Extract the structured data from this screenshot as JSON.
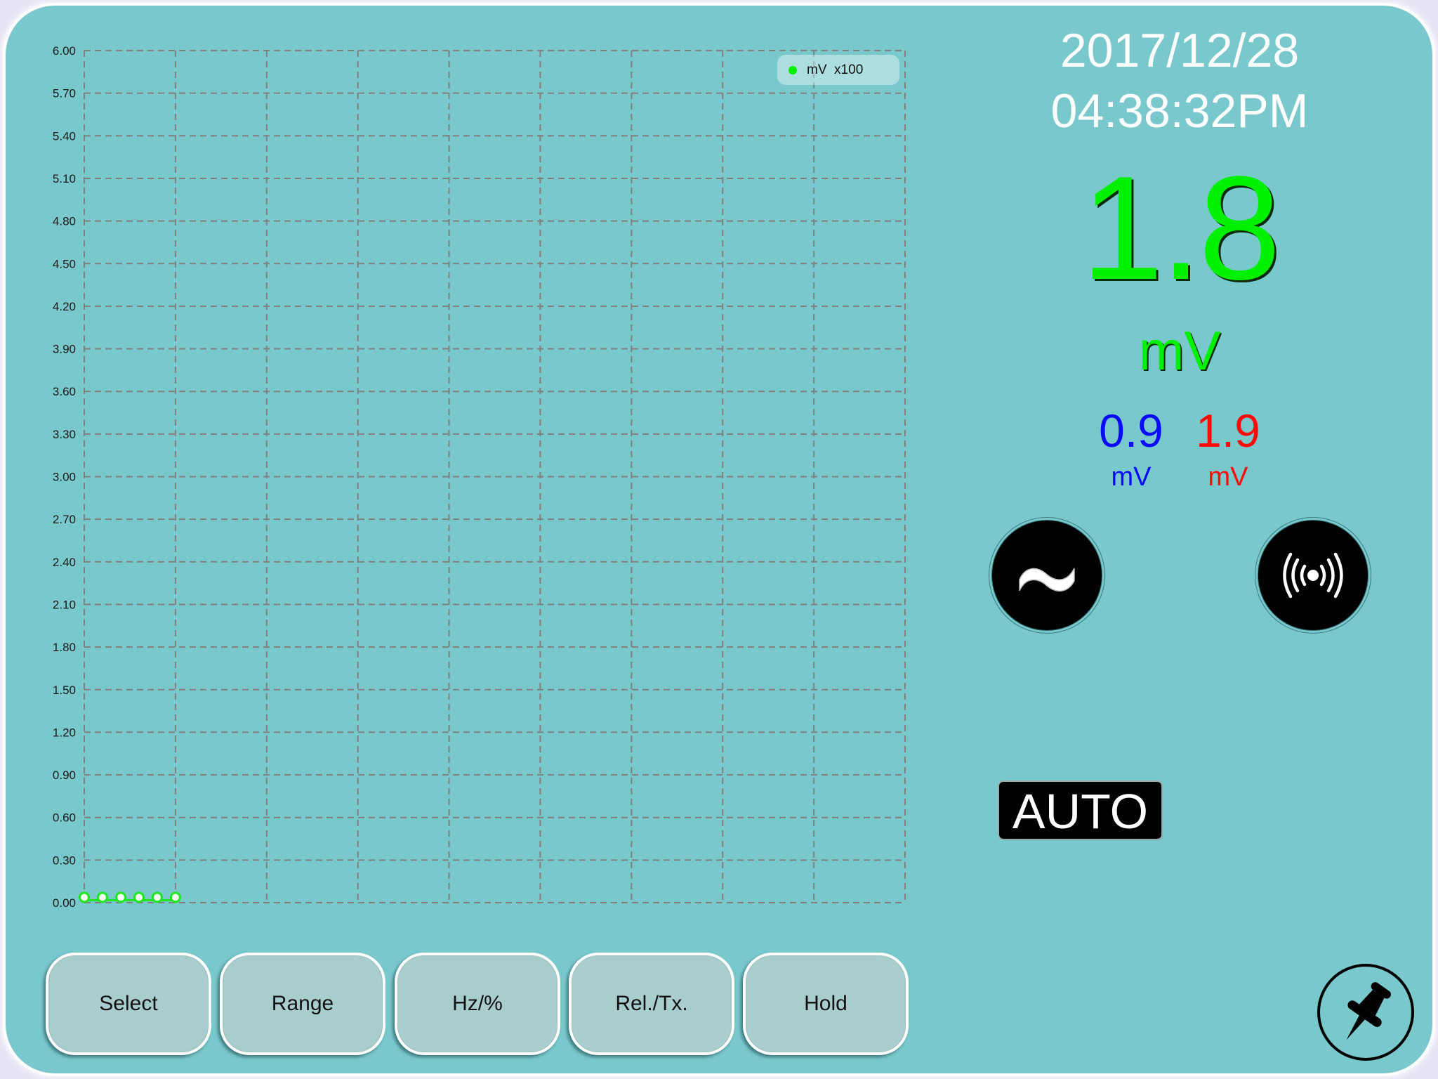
{
  "app": {
    "colors": {
      "background": "#79c8cc",
      "main_reading": "#00f000",
      "min_reading": "#0a0aff",
      "max_reading": "#ff0a0a",
      "series": "#1ee61e",
      "grid": "#808080"
    }
  },
  "datetime": {
    "date": "2017/12/28",
    "time": "04:38:32PM"
  },
  "reading": {
    "value": "1.8",
    "unit": "mV",
    "min": {
      "value": "0.9",
      "unit": "mV"
    },
    "max": {
      "value": "1.9",
      "unit": "mV"
    }
  },
  "mode_buttons": {
    "ac": {
      "icon": "ac-wave-icon",
      "glyph": "~"
    },
    "continuity": {
      "icon": "sound-wave-icon"
    }
  },
  "range_mode": "AUTO",
  "function_buttons": [
    {
      "label": "Select"
    },
    {
      "label": "Range"
    },
    {
      "label": "Hz/%"
    },
    {
      "label": "Rel./Tx."
    },
    {
      "label": "Hold"
    }
  ],
  "pin_button": {
    "icon": "pushpin-icon"
  },
  "chart_data": {
    "type": "line",
    "title": "",
    "xlabel": "",
    "ylabel": "",
    "ylim": [
      0,
      6
    ],
    "y_ticks": [
      "0.00",
      "0.30",
      "0.60",
      "0.90",
      "1.20",
      "1.50",
      "1.80",
      "2.10",
      "2.40",
      "2.70",
      "3.00",
      "3.30",
      "3.60",
      "3.90",
      "4.20",
      "4.50",
      "4.80",
      "5.10",
      "5.40",
      "5.70",
      "6.00"
    ],
    "x_divisions": 9,
    "x_points_per_division": 5,
    "grid": true,
    "legend": {
      "placement": "top-right",
      "entries": [
        {
          "label": "mV  x100",
          "color": "#00f000"
        }
      ]
    },
    "series": [
      {
        "name": "mV x100",
        "x": [
          0,
          1,
          2,
          3,
          4,
          5
        ],
        "values": [
          0.018,
          0.018,
          0.018,
          0.018,
          0.018,
          0.018
        ]
      }
    ]
  }
}
